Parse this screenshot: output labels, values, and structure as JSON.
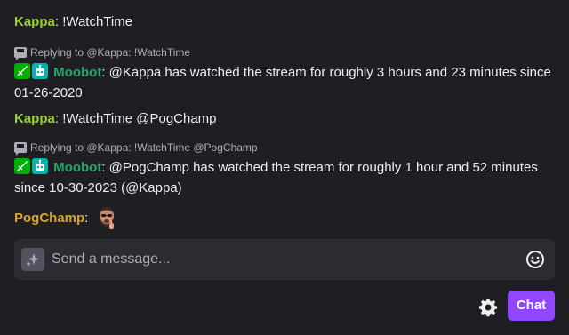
{
  "colors": {
    "kappa": "#9ace32",
    "moobot": "#23a66e",
    "pogchamp": "#daa520",
    "accent": "#9147ff"
  },
  "messages": [
    {
      "user": "Kappa",
      "sep": ": ",
      "text": "!WatchTime"
    },
    {
      "reply_header": "Replying to @Kappa: !WatchTime",
      "badges": [
        "moderator-sword-icon",
        "bot-robot-icon"
      ],
      "user": "Moobot",
      "sep": ": ",
      "text": "@Kappa has watched the stream for roughly 3 hours and 23 minutes since 01-26-2020"
    },
    {
      "user": "Kappa",
      "sep": ": ",
      "text": "!WatchTime @PogChamp"
    },
    {
      "reply_header": "Replying to @Kappa: !WatchTime @PogChamp",
      "badges": [
        "moderator-sword-icon",
        "bot-robot-icon"
      ],
      "user": "Moobot",
      "sep": ": ",
      "text": "@PogChamp has watched the stream for roughly 1 hour and 52 minutes since 10-30-2023 (@Kappa)"
    },
    {
      "user": "PogChamp",
      "sep": ": ",
      "emote": "pogchamp-emote"
    }
  ],
  "input": {
    "placeholder": "Send a message..."
  },
  "chat_button": "Chat"
}
